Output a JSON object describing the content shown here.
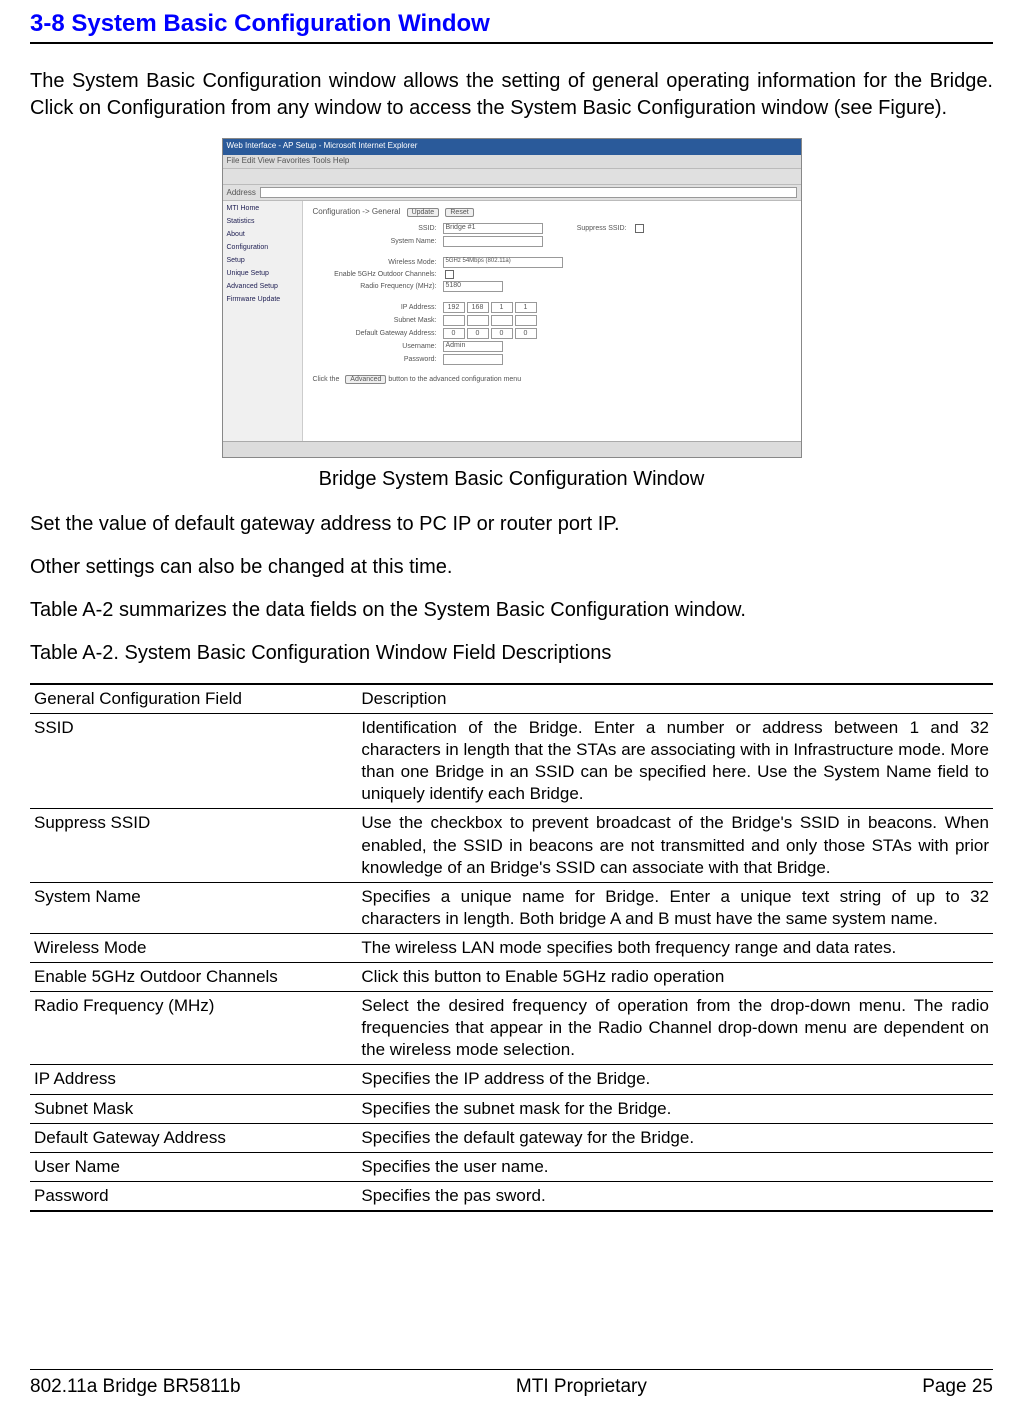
{
  "section_title": "3-8 System Basic Configuration Window",
  "intro_paragraph": "The System Basic Configuration window allows the setting of general operating information for the Bridge. Click on Configuration from any window to access the System Basic Configuration window (see Figure).",
  "figure_caption": "Bridge System Basic Configuration Window",
  "post_fig_1": "Set the value of default gateway address to PC IP or router port IP.",
  "post_fig_2": "Other settings can also be changed at this time.",
  "post_fig_3": "Table A-2 summarizes the data fields on the System Basic Configuration window.",
  "table_title": "Table A-2. System Basic Configuration Window Field Descriptions",
  "table": {
    "col_headers": [
      "General Configuration Field",
      "Description"
    ],
    "rows": [
      [
        "SSID",
        "Identification of the Bridge. Enter a number or address between 1 and 32 characters in length that the STAs are associating with in Infrastructure mode. More than one Bridge in an SSID can be specified here. Use the System Name field to uniquely identify each Bridge."
      ],
      [
        "Suppress SSID",
        "Use the checkbox to prevent broadcast of the  Bridge's SSID in beacons. When enabled, the SSID in beacons are not transmitted and only those STAs with prior knowledge of an Bridge's SSID can associate with that Bridge."
      ],
      [
        "System Name",
        "Specifies a unique name for Bridge. Enter a unique text string of up to 32 characters in length. Both bridge A and B must have the same system name."
      ],
      [
        "Wireless Mode",
        "The wireless LAN mode specifies both frequency range and data rates."
      ],
      [
        "Enable 5GHz Outdoor Channels",
        "Click this button to Enable 5GHz radio operation"
      ],
      [
        "Radio Frequency (MHz)",
        "Select the desired frequency of operation from the drop-down menu. The radio frequencies that appear in the Radio Channel drop-down menu are dependent on the wireless mode selection."
      ],
      [
        "IP Address",
        "Specifies the IP address of the Bridge."
      ],
      [
        "Subnet Mask",
        "Specifies the subnet mask for the Bridge."
      ],
      [
        "Default Gateway Address",
        "Specifies the default gateway for the Bridge."
      ],
      [
        "User Name",
        "Specifies the user name."
      ],
      [
        "Password",
        "Specifies the pas sword."
      ]
    ]
  },
  "screenshot": {
    "title": "Web Interface - AP Setup - Microsoft Internet Explorer",
    "menubar": "File  Edit  View  Favorites  Tools  Help",
    "address_label": "Address",
    "sidebar": [
      "MTI Home",
      "Statistics",
      "About",
      "Configuration",
      "Setup",
      "Unique Setup",
      "Advanced Setup",
      "Firmware Update"
    ],
    "heading": "Configuration -> General",
    "update_btn": "Update",
    "reset_btn": "Reset",
    "advanced_btn": "Advanced",
    "advanced_note": "Click the  button to the advanced configuration menu",
    "fields": {
      "ssid_lbl": "SSID:",
      "ssid_val": "Bridge #1",
      "suppress_lbl": "Suppress SSID:",
      "sysname_lbl": "System Name:",
      "wmode_lbl": "Wireless Mode:",
      "wmode_val": "5GHz 54Mbps (802.11a)",
      "outdoor_lbl": "Enable 5GHz Outdoor Channels:",
      "rfreq_lbl": "Radio Frequency (MHz):",
      "rfreq_val": "5180",
      "ip_lbl": "IP Address:",
      "ip_vals": [
        "192",
        "168",
        "1",
        "1"
      ],
      "mask_lbl": "Subnet Mask:",
      "gw_lbl": "Default Gateway Address:",
      "gw_vals": [
        "0",
        "0",
        "0",
        "0"
      ],
      "user_lbl": "Username:",
      "user_val": "Admin",
      "pass_lbl": "Password:"
    }
  },
  "footer": {
    "left": "802.11a Bridge  BR5811b",
    "center": "MTI Proprietary",
    "right": "Page 25"
  }
}
